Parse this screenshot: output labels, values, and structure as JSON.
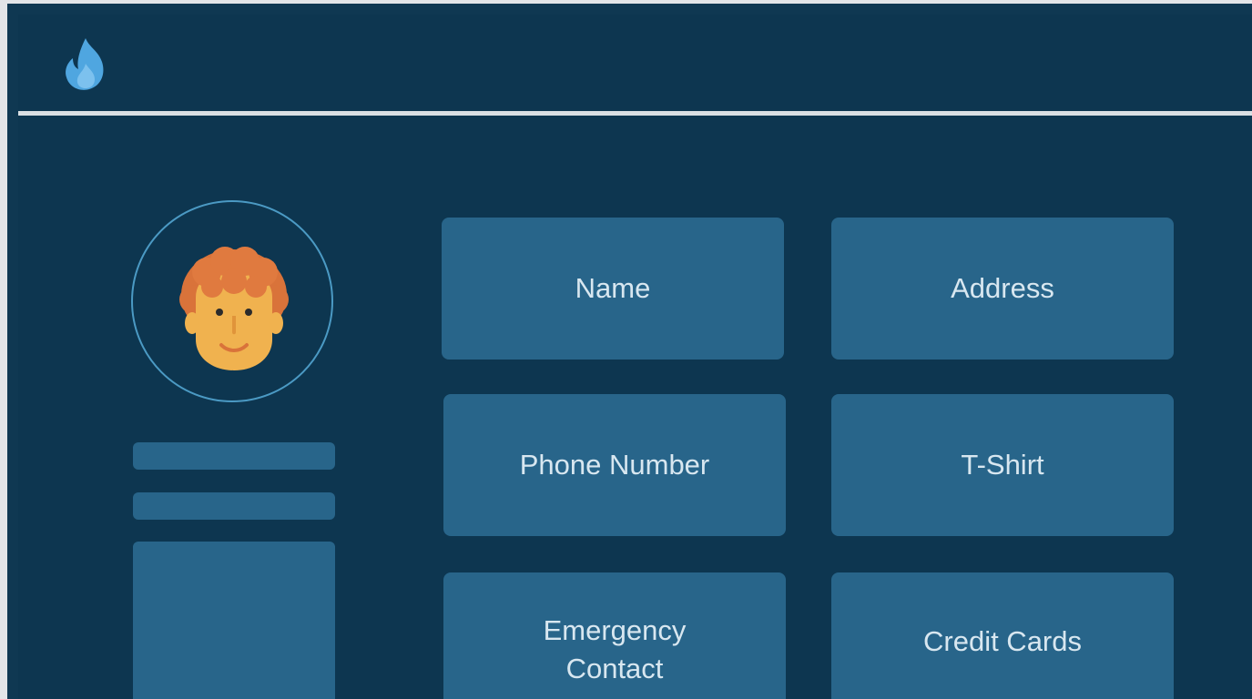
{
  "header": {
    "logo_icon": "flame-icon",
    "accent_color": "#4fa6e0"
  },
  "profile": {
    "avatar_icon": "person-avatar-icon"
  },
  "cards": {
    "name": "Name",
    "address": "Address",
    "phone_number": "Phone Number",
    "tshirt": "T-Shirt",
    "emergency_contact": "Emergency Contact",
    "credit_cards": "Credit Cards"
  },
  "colors": {
    "background": "#0d3650",
    "card": "#28658a",
    "card_text": "#d8e7f0",
    "ring": "#4b9ac4"
  }
}
